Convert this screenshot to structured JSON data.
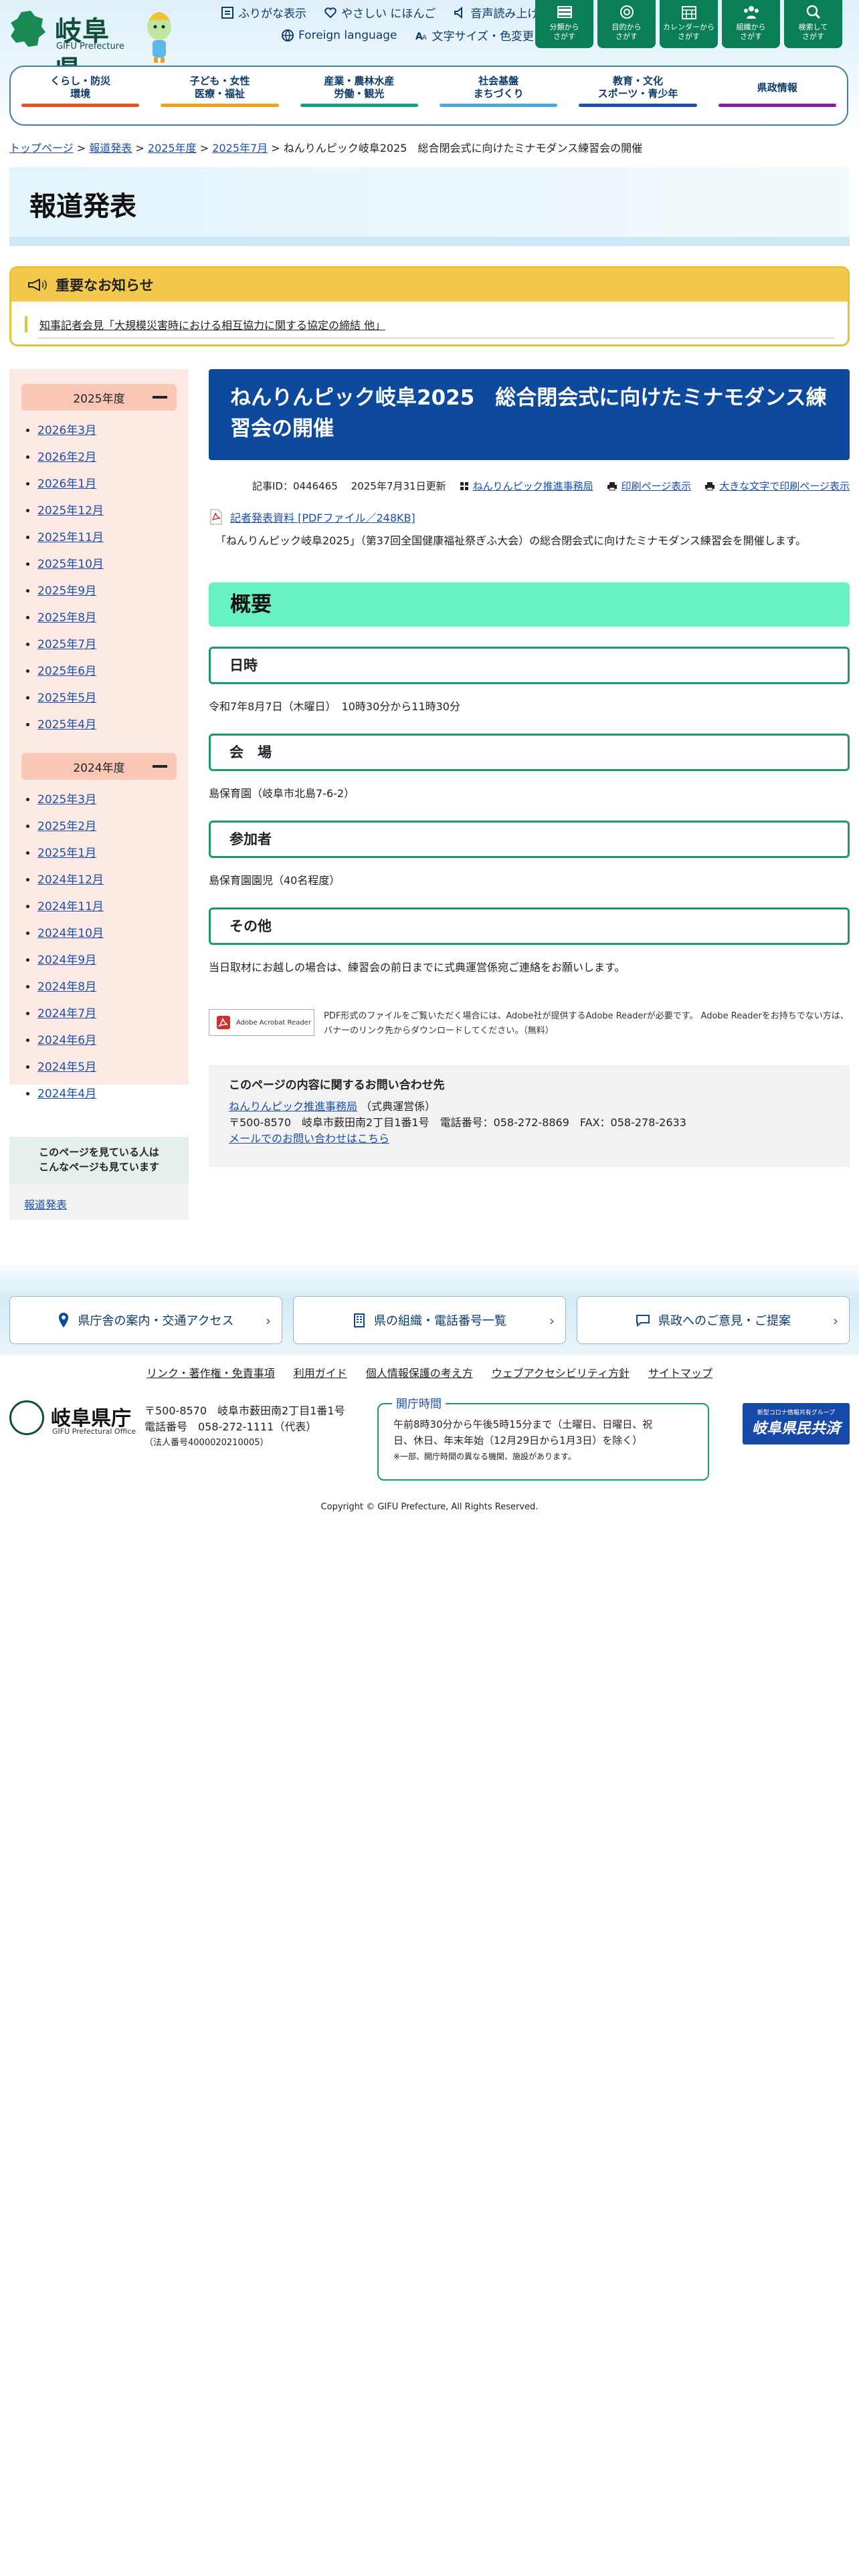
{
  "header": {
    "logo_jp": "岐阜県",
    "logo_en": "GIFU Prefecture",
    "util1": [
      "ふりがな表示",
      "やさしい にほんご",
      "音声読み上げ"
    ],
    "util2": [
      "Foreign language",
      "文字サイズ・色変更"
    ],
    "top_buttons": [
      [
        "分類から",
        "さがす"
      ],
      [
        "目的から",
        "さがす"
      ],
      [
        "カレンダーから",
        "さがす"
      ],
      [
        "組織から",
        "さがす"
      ],
      [
        "検索して",
        "さがす"
      ]
    ],
    "gnav": [
      {
        "l1": "くらし・防災",
        "l2": "環境",
        "color": "#e8501e"
      },
      {
        "l1": "子ども・女性",
        "l2": "医療・福祉",
        "color": "#f0a020"
      },
      {
        "l1": "産業・農林水産",
        "l2": "労働・観光",
        "color": "#12a17a"
      },
      {
        "l1": "社会基盤",
        "l2": "まちづくり",
        "color": "#4aa8e0"
      },
      {
        "l1": "教育・文化",
        "l2": "スポーツ・青少年",
        "color": "#1a4fb0"
      },
      {
        "l1": "県政情報",
        "l2": "",
        "color": "#8a1aa0"
      }
    ]
  },
  "breadcrumb": {
    "items": [
      "トップページ",
      "報道発表",
      "2025年度",
      "2025年7月"
    ],
    "sep": ">",
    "current": "ねんりんピック岐阜2025　総合閉会式に向けたミナモダンス練習会の開催"
  },
  "page_title": "報道発表",
  "notice": {
    "heading": "重要なお知らせ",
    "item": "知事記者会見「大規模災害時における相互協力に関する協定の締結 他」"
  },
  "sidebar": {
    "years": [
      {
        "label": "2025年度",
        "months": [
          "2026年3月",
          "2026年2月",
          "2026年1月",
          "2025年12月",
          "2025年11月",
          "2025年10月",
          "2025年9月",
          "2025年8月",
          "2025年7月",
          "2025年6月",
          "2025年5月",
          "2025年4月"
        ]
      },
      {
        "label": "2024年度",
        "months": [
          "2025年3月",
          "2025年2月",
          "2025年1月",
          "2024年12月",
          "2024年11月",
          "2024年10月",
          "2024年9月",
          "2024年8月",
          "2024年7月",
          "2024年6月",
          "2024年5月",
          "2024年4月"
        ]
      }
    ],
    "also_heading_1": "このページを見ている人は",
    "also_heading_2": "こんなページも見ています",
    "also_link": "報道発表"
  },
  "article": {
    "title": "ねんりんピック岐阜2025　総合閉会式に向けたミナモダンス練習会の開催",
    "id": "記事ID：0446465",
    "updated": "2025年7月31日更新",
    "org_link": "ねんりんピック推進事務局",
    "print": "印刷ページ表示",
    "print_large": "大きな文字で印刷ページ表示",
    "pdf": "記者発表資料 [PDFファイル／248KB]",
    "intro": "「ねんりんピック岐阜2025」（第37回全国健康福祉祭ぎふ大会）の総合閉会式に向けたミナモダンス練習会を開催します。",
    "overview": "概要",
    "sections": [
      {
        "h": "日時",
        "p": "令和7年8月7日（木曜日）　10時30分から11時30分"
      },
      {
        "h": "会　場",
        "p": "島保育園（岐阜市北島7-6-2）"
      },
      {
        "h": "参加者",
        "p": "島保育園園児（40名程度）"
      },
      {
        "h": "その他",
        "p": "当日取材にお越しの場合は、練習会の前日までに式典運営係宛ご連絡をお願いします。"
      }
    ],
    "acrobat_badge": "Adobe Acrobat Reader",
    "acrobat_text_1": "PDF形式のファイルをご覧いただく場合には、Adobe社が提供するAdobe Readerが必要です。 Adobe Readerをお持ちでない方は、",
    "acrobat_text_2": "バナーのリンク先からダウンロードしてください。（無料）"
  },
  "contact": {
    "heading": "このページの内容に関するお問い合わせ先",
    "org": "ねんりんピック推進事務局",
    "dept": "（式典運営係）",
    "address": "〒500-8570　岐阜市薮田南2丁目1番1号　電話番号：058-272-8869　FAX：058-278-2633",
    "mail": "メールでのお問い合わせはこちら"
  },
  "footer": {
    "buttons": [
      "県庁舎の案内・交通アクセス",
      "県の組織・電話番号一覧",
      "県政へのご意見・ご提案"
    ],
    "links": [
      "リンク・著作権・免責事項",
      "利用ガイド",
      "個人情報保護の考え方",
      "ウェブアクセシビリティ方針",
      "サイトマップ"
    ],
    "logo_jp": "岐阜県庁",
    "logo_en": "GIFU Prefectural Office",
    "addr": "〒500-8570　岐阜市薮田南2丁目1番1号",
    "tel": "電話番号　058-272-1111（代表）",
    "corp": "（法人番号4000020210005）",
    "hours_h": "開庁時間",
    "hours_1": "午前8時30分から午後5時15分まで（土曜日、日曜日、祝",
    "hours_2": "日、休日、年末年始（12月29日から1月3日）を除く）",
    "hours_note": "※一部、開庁時間の異なる機関、施設があります。",
    "banner_small": "新型コロナ情報共有グループ",
    "banner_big": "岐阜県民共済",
    "copyright": "Copyright © GIFU Prefecture, All Rights Reserved."
  }
}
